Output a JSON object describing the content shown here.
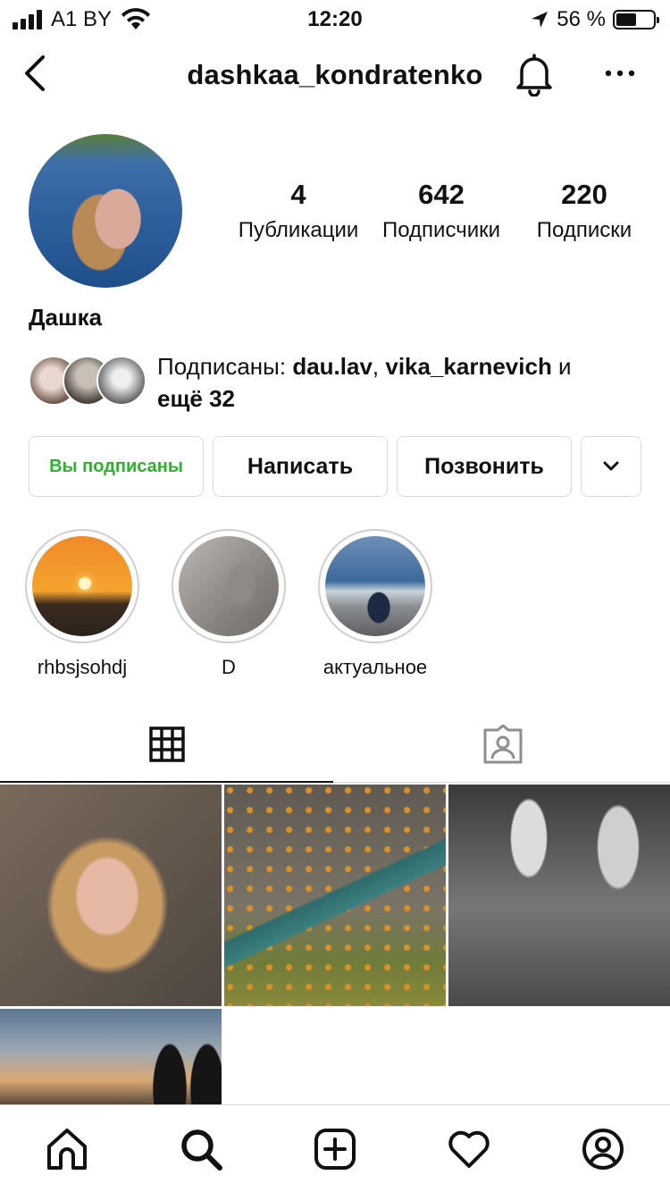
{
  "status_bar": {
    "carrier": "A1 BY",
    "time": "12:20",
    "battery_percent": "56 %",
    "battery_level": 0.56
  },
  "header": {
    "username": "dashkaa_kondratenko",
    "icons": [
      "back-icon",
      "bell-icon",
      "more-icon"
    ]
  },
  "profile": {
    "display_name": "Дашка",
    "stats": [
      {
        "value": "4",
        "label": "Публикации"
      },
      {
        "value": "642",
        "label": "Подписчики"
      },
      {
        "value": "220",
        "label": "Подписки"
      }
    ],
    "followed_by": {
      "prefix": "Подписаны: ",
      "user1": "dau.lav",
      "sep": ", ",
      "user2": "vika_karnevich",
      "and": " и",
      "more": "ещё 32"
    }
  },
  "buttons": {
    "following": "Вы подписаны",
    "message": "Написать",
    "call": "Позвонить"
  },
  "highlights": [
    {
      "label": "rhbsjsohdj"
    },
    {
      "label": "D"
    },
    {
      "label": "актуальное"
    }
  ],
  "tabs": [
    "grid-icon",
    "tagged-icon"
  ],
  "bottom_nav": [
    "home-icon",
    "search-icon",
    "new-post-icon",
    "heart-icon",
    "profile-icon"
  ],
  "colors": {
    "following_text": "#2bb32b",
    "border": "#dbdbdb"
  }
}
